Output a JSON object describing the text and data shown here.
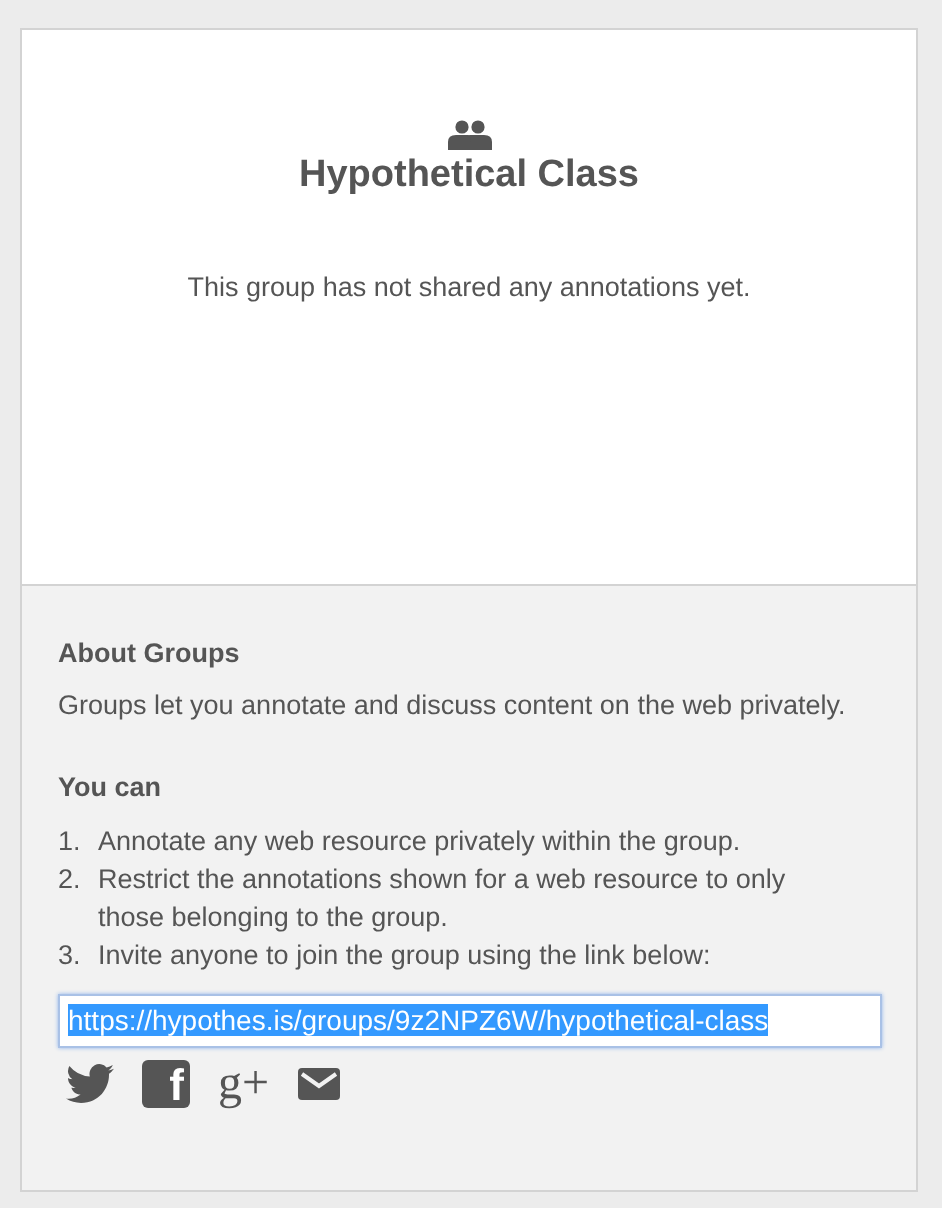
{
  "group": {
    "name": "Hypothetical Class",
    "empty_message": "This group has not shared any annotations yet."
  },
  "about": {
    "heading": "About Groups",
    "text": "Groups let you annotate and discuss content on the web privately."
  },
  "you_can": {
    "heading": "You can",
    "items": [
      {
        "marker": "1.",
        "text": "Annotate any web resource privately within the group."
      },
      {
        "marker": "2.",
        "text": "Restrict the annotations shown for a web resource to only those belonging to the group."
      },
      {
        "marker": "3.",
        "text": "Invite anyone to join the group using the link below:"
      }
    ]
  },
  "link": {
    "value": "https://hypothes.is/groups/9z2NPZ6W/hypothetical-class",
    "selected": true
  },
  "share": [
    {
      "kind": "twitter"
    },
    {
      "kind": "facebook",
      "glyph": "f"
    },
    {
      "kind": "google",
      "glyph": "g+"
    },
    {
      "kind": "email"
    }
  ]
}
